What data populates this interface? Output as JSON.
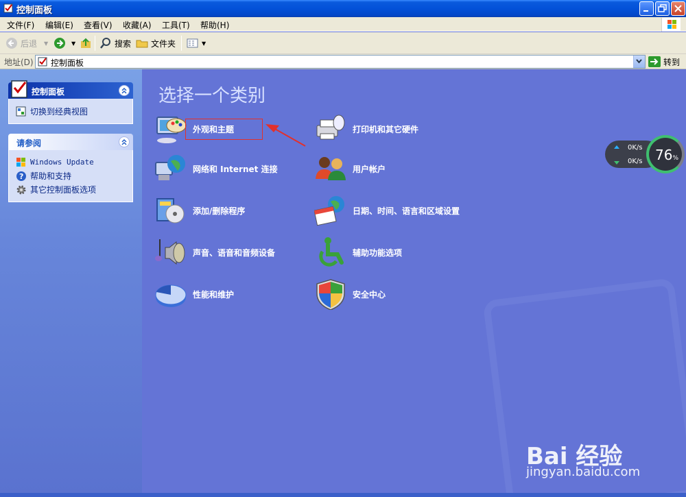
{
  "window": {
    "title": "控制面板"
  },
  "menu": [
    "文件(F)",
    "编辑(E)",
    "查看(V)",
    "收藏(A)",
    "工具(T)",
    "帮助(H)"
  ],
  "toolbar": {
    "back_label": "后退",
    "search_label": "搜索",
    "folders_label": "文件夹"
  },
  "address": {
    "label": "地址(D)",
    "value": "控制面板",
    "go_label": "转到"
  },
  "sidebar": {
    "control_panel": {
      "title": "控制面板",
      "switch_view": "切换到经典视图"
    },
    "see_also": {
      "title": "请参阅",
      "items": [
        "Windows Update",
        "帮助和支持",
        "其它控制面板选项"
      ]
    }
  },
  "main": {
    "heading": "选择一个类别",
    "categories_left": [
      "外观和主题",
      "网络和 Internet 连接",
      "添加/删除程序",
      "声音、语音和音频设备",
      "性能和维护"
    ],
    "categories_right": [
      "打印机和其它硬件",
      "用户帐户",
      "日期、时间、语言和区域设置",
      "辅助功能选项",
      "安全中心"
    ]
  },
  "speed_widget": {
    "upload": "0K/s",
    "download": "0K/s",
    "percent": "76",
    "percent_sign": "%"
  },
  "watermark": {
    "brand": "Bai 经验",
    "url": "jingyan.baidu.com"
  },
  "colors": {
    "titlebar": "#0351d8",
    "main_bg": "#6474d6",
    "highlight": "#e3302b"
  }
}
